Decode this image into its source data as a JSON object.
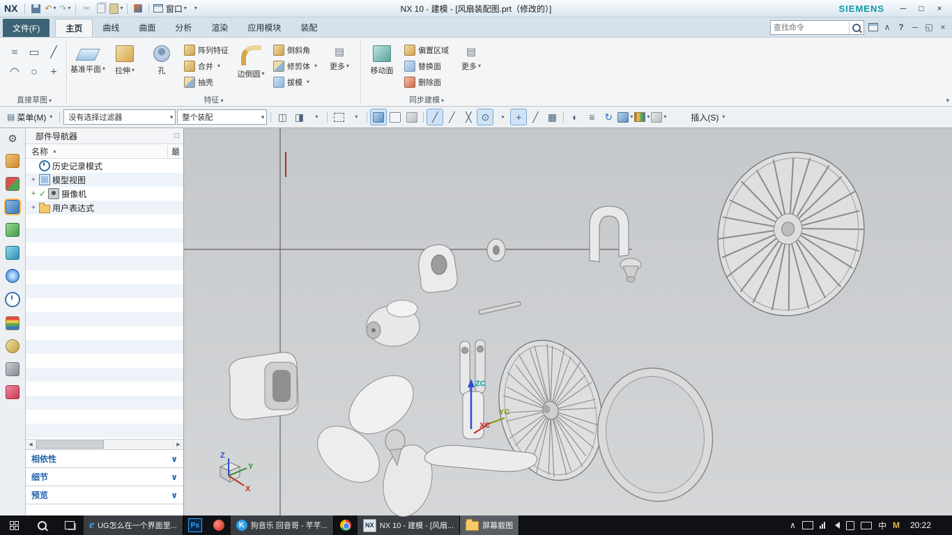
{
  "title_bar": {
    "logo": "NX",
    "title": "NX 10 - 建模 - [风扇装配图.prt（修改的）]",
    "window_menu": "窗口",
    "brand": "SIEMENS"
  },
  "tabs": {
    "file": "文件(F)",
    "home": "主页",
    "curve": "曲线",
    "surface": "曲面",
    "analysis": "分析",
    "render": "渲染",
    "application": "应用模块",
    "assembly": "装配"
  },
  "find": {
    "placeholder": "查找命令"
  },
  "ribbon": {
    "group_direct_sketch": "直接草图",
    "group_feature": "特征",
    "group_synchronous": "同步建模",
    "datum_plane": "基准平面",
    "extrude": "拉伸",
    "hole": "孔",
    "pattern_feature": "阵列特征",
    "unite": "合并",
    "shell": "抽壳",
    "edge_blend": "边倒圆",
    "chamfer": "倒斜角",
    "trim_body": "修剪体",
    "draft": "拔模",
    "more_feature": "更多",
    "move_face": "移动面",
    "offset_region": "偏置区域",
    "replace_face": "替换面",
    "delete_face": "删除面",
    "more_sync": "更多"
  },
  "toolbar": {
    "menu": "菜单(M)",
    "filter": "没有选择过滤器",
    "scope": "整个装配",
    "insert": "插入(S)"
  },
  "navigator": {
    "title": "部件导航器",
    "col_name": "名称",
    "col_last": "最",
    "items": [
      {
        "label": "历史记录模式"
      },
      {
        "label": "模型视图"
      },
      {
        "label": "摄像机"
      },
      {
        "label": "用户表达式"
      }
    ],
    "sec_dependencies": "相依性",
    "sec_details": "细节",
    "sec_preview": "预览"
  },
  "viewport": {
    "zc": "ZC",
    "yc": "YC",
    "xc": "XC",
    "x": "X",
    "y": "Y",
    "z": "Z"
  },
  "taskbar": {
    "task_browser": "UG怎么在一个界面里...",
    "task_music": "狗音乐 回音哥 - 芊芊...",
    "task_nx": "NX 10 - 建模 - [风扇...",
    "task_snip": "屏幕截图",
    "lang": "中",
    "ime": "M",
    "time": "20:22"
  },
  "icons": {
    "caret": "▾",
    "chevron": "∨",
    "up": "∧",
    "sort": "▲",
    "left": "◀",
    "right": "▶",
    "close": "×",
    "min": "─",
    "max": "□",
    "restore": "◱",
    "help": "?",
    "undo": "↶",
    "redo": "↷",
    "cut": "✂",
    "spline": "≈",
    "rect": "▭",
    "line": "╱",
    "arc": "◠",
    "circle": "○",
    "point": "+",
    "more": "▤",
    "boxl": "◫",
    "boxr": "◨",
    "cross": "╳",
    "center": "⊙",
    "quad": "◔",
    "grid": "▦",
    "half": "◐",
    "layers": "≡",
    "rotate": "↻",
    "gear": "⚙",
    "pin": "□",
    "ie": "e",
    "ps": "Ps",
    "kugou": "K",
    "nx": "NX"
  }
}
